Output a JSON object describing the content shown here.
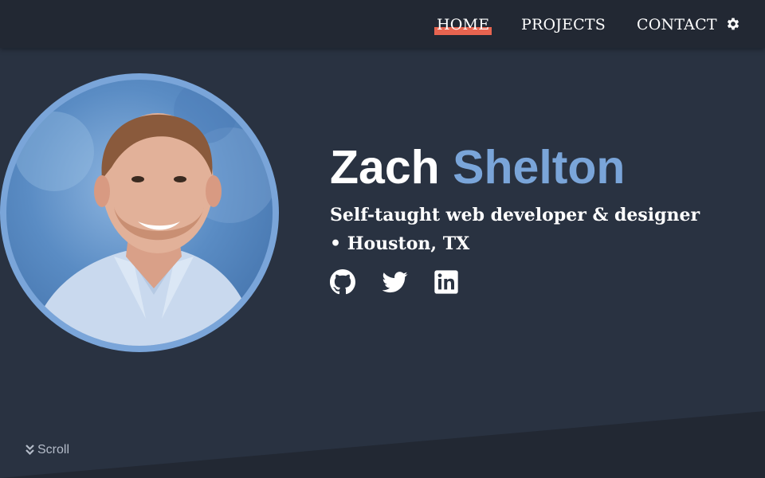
{
  "nav": {
    "items": [
      {
        "label": "HOME",
        "active": true
      },
      {
        "label": "PROJECTS",
        "active": false
      },
      {
        "label": "CONTACT",
        "active": false
      }
    ],
    "settings_icon": "gear-icon"
  },
  "hero": {
    "first_name": "Zach",
    "last_name": "Shelton",
    "tagline": "Self-taught web developer & designer • Houston, TX",
    "social": [
      {
        "icon": "github-icon"
      },
      {
        "icon": "twitter-icon"
      },
      {
        "icon": "linkedin-icon"
      }
    ]
  },
  "scroll": {
    "label": "Scroll",
    "icon": "chevrons-down-icon"
  },
  "colors": {
    "background": "#293241",
    "navbar": "#222833",
    "accent_blue": "#7aa5d9",
    "active_underline": "#e76450",
    "text": "#ffffff"
  }
}
